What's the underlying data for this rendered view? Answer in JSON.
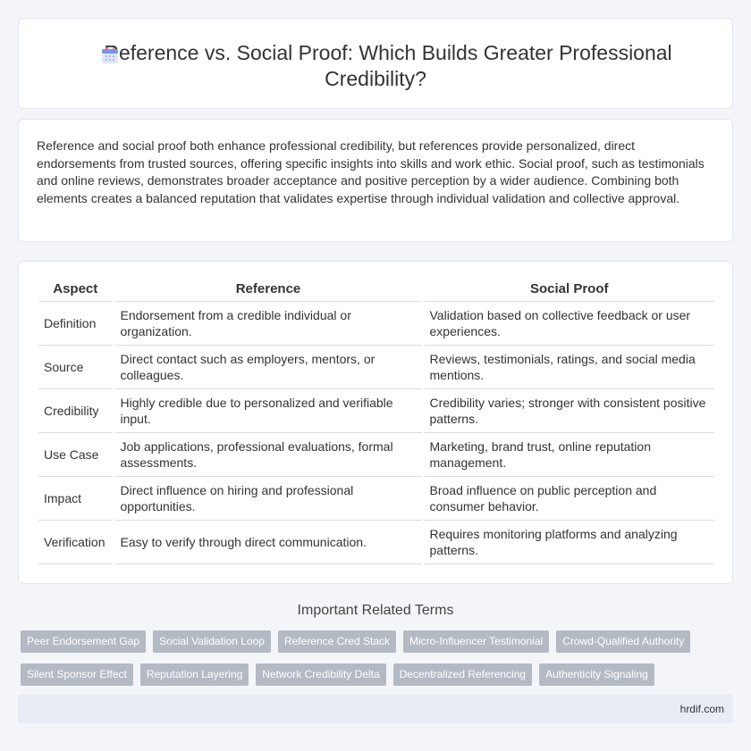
{
  "header": {
    "title": "Reference vs. Social Proof: Which Builds Greater Professional Credibility?",
    "icon": "calendar-icon"
  },
  "summary": {
    "text": "Reference and social proof both enhance professional credibility, but references provide personalized, direct endorsements from trusted sources, offering specific insights into skills and work ethic. Social proof, such as testimonials and online reviews, demonstrates broader acceptance and positive perception by a wider audience. Combining both elements creates a balanced reputation that validates expertise through individual validation and collective approval."
  },
  "table": {
    "headers": [
      "Aspect",
      "Reference",
      "Social Proof"
    ],
    "rows": [
      {
        "aspect": "Definition",
        "reference": "Endorsement from a credible individual or organization.",
        "social": "Validation based on collective feedback or user experiences."
      },
      {
        "aspect": "Source",
        "reference": "Direct contact such as employers, mentors, or colleagues.",
        "social": "Reviews, testimonials, ratings, and social media mentions."
      },
      {
        "aspect": "Credibility",
        "reference": "Highly credible due to personalized and verifiable input.",
        "social": "Credibility varies; stronger with consistent positive patterns."
      },
      {
        "aspect": "Use Case",
        "reference": "Job applications, professional evaluations, formal assessments.",
        "social": "Marketing, brand trust, online reputation management."
      },
      {
        "aspect": "Impact",
        "reference": "Direct influence on hiring and professional opportunities.",
        "social": "Broad influence on public perception and consumer behavior."
      },
      {
        "aspect": "Verification",
        "reference": "Easy to verify through direct communication.",
        "social": "Requires monitoring platforms and analyzing patterns."
      }
    ]
  },
  "related": {
    "title": "Important Related Terms",
    "row1": [
      "Peer Endorsement Gap",
      "Social Validation Loop",
      "Reference Cred Stack",
      "Micro-Influencer Testimonial",
      "Crowd-Qualified Authority"
    ],
    "row2": [
      "Silent Sponsor Effect",
      "Reputation Layering",
      "Network Credibility Delta",
      "Decentralized Referencing",
      "Authenticity Signaling"
    ]
  },
  "footer": {
    "site": "hrdif.com"
  }
}
